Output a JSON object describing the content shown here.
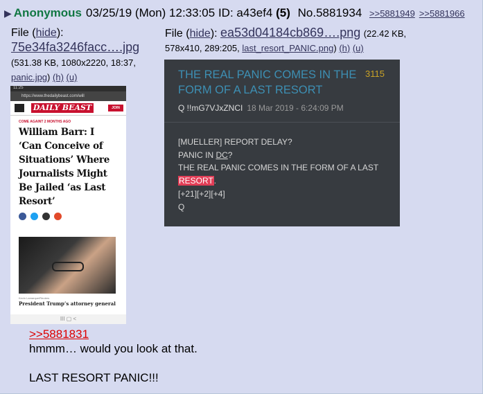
{
  "post": {
    "name": "Anonymous",
    "datetime": "03/25/19 (Mon) 12:33:05",
    "id_label": "ID: a43ef4",
    "id_count": "(5)",
    "number": "No.5881934",
    "backlinks": [
      ">>5881949",
      ">>5881966"
    ]
  },
  "file1": {
    "prefix": "File (",
    "hide": "hide",
    "suffix": "):",
    "name": "75e34fa3246facc….jpg",
    "meta": "(531.38 KB, 1080x2220, 18:37,",
    "orig": "panic.jpg",
    "after_orig": ")",
    "h": "(h)",
    "u": "(u)"
  },
  "file2": {
    "prefix": "File (",
    "hide": "hide",
    "suffix": "):",
    "name": "ea53d04184cb869….png",
    "meta1": "(22.42 KB,",
    "meta2": "578x410, 289:205,",
    "orig": "last_resort_PANIC.png",
    "after_orig": ")",
    "h": "(h)",
    "u": "(u)"
  },
  "thumb1": {
    "status": "11:25",
    "url": "https://www.thedailybeast.com/will",
    "logo": "DAILY BEAST",
    "join": "JOIN",
    "kicker": "COME AGAINT  2 MONTHS AGO",
    "headline": "William Barr: I ‘Can Conceive of Situations’ Where Journalists Might Be Jailed ‘as Last Resort’",
    "credit": "Kevin Lamarque/Reuters",
    "subtext": "President Trump’s attorney general",
    "nav": "III     ▢     <"
  },
  "thumb2": {
    "title": "THE REAL PANIC COMES IN THE FORM OF A LAST RESORT",
    "number": "3115",
    "author": "Q  !!mG7VJxZNCI",
    "date": "18 Mar 2019 - 6:24:09 PM",
    "line1": "[MUELLER] REPORT DELAY?",
    "line2a": "PANIC IN ",
    "line2b": "DC",
    "line2c": "?",
    "line3": "THE REAL PANIC COMES IN THE FORM OF A LAST",
    "line4": "RESORT",
    "line4b": ".",
    "line5": "[+21][+2][+4]",
    "line6": "Q"
  },
  "message": {
    "quote": ">>5881831",
    "line1": "hmmm… would you look at that.",
    "line2": "LAST RESORT PANIC!!!"
  },
  "colors": {
    "background": "#d6daf0",
    "name": "#117743",
    "link": "#34345c",
    "quote_link": "#dd0000",
    "thumb2_bg": "#373b40",
    "thumb2_title": "#3d8fb3",
    "highlight": "#e23e57"
  }
}
